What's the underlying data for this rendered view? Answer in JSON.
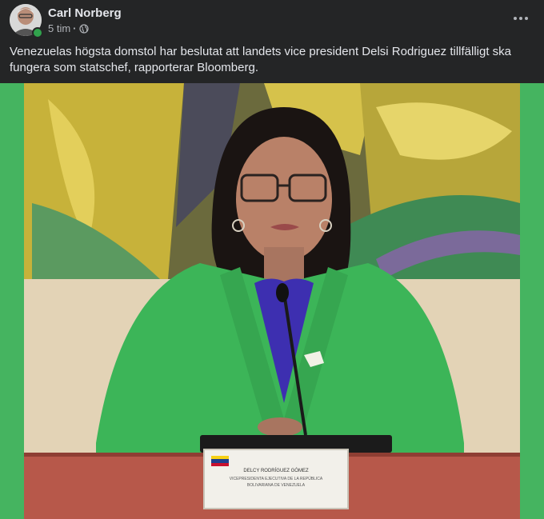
{
  "post": {
    "author": "Carl Norberg",
    "time": "5 tim",
    "separator": "·",
    "text": "Venezuelas högsta domstol har beslutat att landets vice president Delsi Rodriguez tillfälligt ska fungera som statschef, rapporterar Bloomberg.",
    "more_icon": "more-horizontal-icon",
    "privacy_icon": "globe-icon"
  },
  "image": {
    "nameplate_line1": "DELCY RODRÍGUEZ GÓMEZ",
    "nameplate_line2": "VICEPRESIDENTA EJECUTIVA DE LA REPÚBLICA",
    "nameplate_line3": "BOLIVARIANA DE VENEZUELA"
  },
  "colors": {
    "background": "#242526",
    "text": "#e4e6eb",
    "meta": "#b0b3b8",
    "photo_border": "#45b460",
    "jacket": "#3cb558",
    "online": "#31a24c"
  }
}
